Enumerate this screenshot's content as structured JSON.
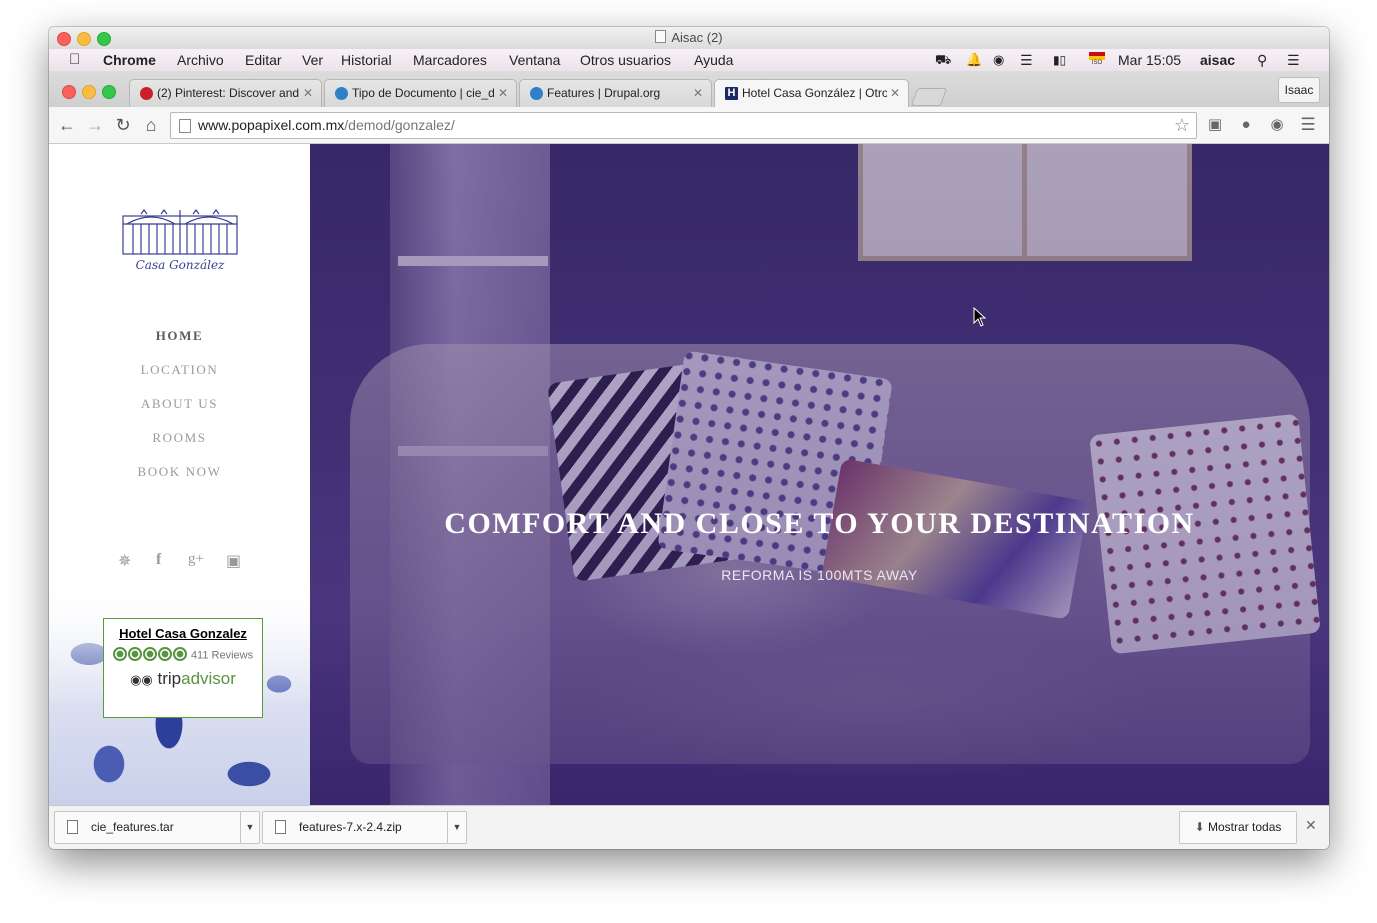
{
  "window": {
    "title": "Aisac (2)"
  },
  "menubar": {
    "items": [
      "Chrome",
      "Archivo",
      "Editar",
      "Ver",
      "Historial",
      "Marcadores",
      "Ventana",
      "Otros usuarios",
      "Ayuda"
    ],
    "clock": "Mar 15:05",
    "user": "aisac",
    "flag_label": "ISO"
  },
  "tabs": [
    {
      "label": "(2) Pinterest: Discover and",
      "favicon_color": "#cb2027"
    },
    {
      "label": "Tipo de Documento | cie_d",
      "favicon_color": "#2f80c6"
    },
    {
      "label": "Features | Drupal.org",
      "favicon_color": "#2f80c6"
    },
    {
      "label": "Hotel Casa González | Otro",
      "favicon_color": "#1b2a63",
      "favicon_letter": "H",
      "active": true
    }
  ],
  "profile": "Isaac",
  "address_bar": {
    "domain": "www.popapixel.com.mx",
    "path": "/demod/gonzalez/"
  },
  "site": {
    "logo_text": "Casa González",
    "nav": [
      "HOME",
      "LOCATION",
      "ABOUT US",
      "ROOMS",
      "BOOK NOW"
    ],
    "nav_active": 0,
    "social_icons": [
      "twitter-icon",
      "facebook-icon",
      "google-plus-icon",
      "instagram-icon"
    ],
    "tripadvisor": {
      "hotel_name": "Hotel Casa Gonzalez",
      "reviews": "411 Reviews",
      "rating": 5,
      "brand_trip": "trip",
      "brand_advisor": "advisor"
    },
    "hero": {
      "title": "COMFORT AND CLOSE TO YOUR DESTINATION",
      "subtitle": "REFORMA IS 100MTS AWAY"
    }
  },
  "downloads": {
    "items": [
      "cie_features.tar",
      "features-7.x-2.4.zip"
    ],
    "show_all": "Mostrar todas"
  }
}
